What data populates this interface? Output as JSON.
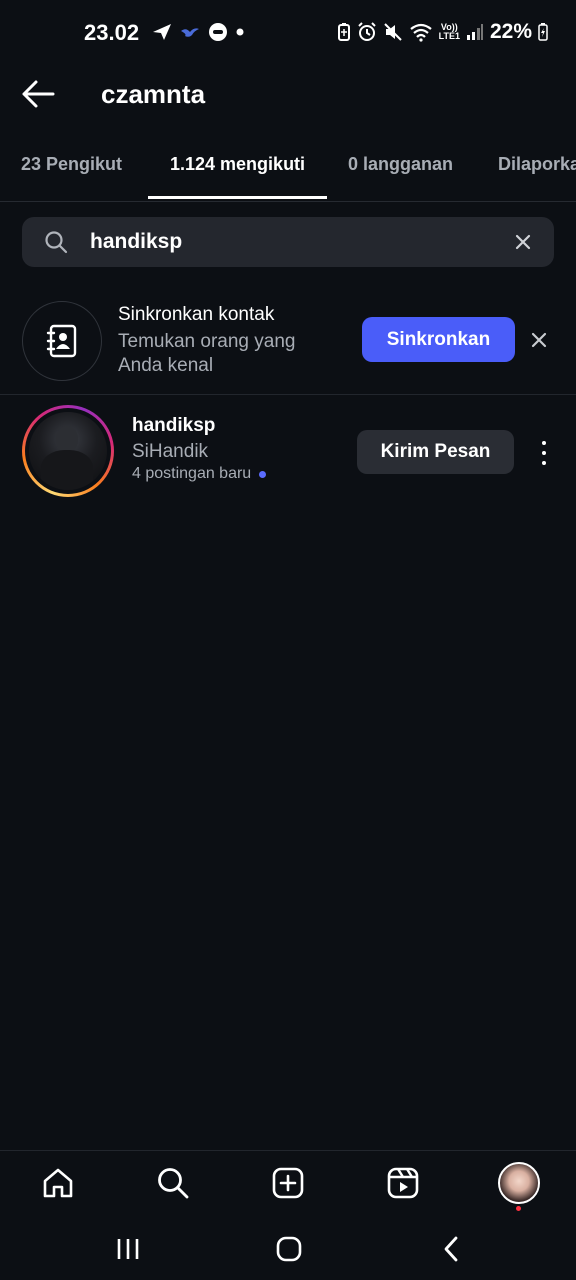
{
  "status_bar": {
    "time": "23.02",
    "battery": "22%",
    "network_top": "Vo))",
    "network_bottom": "LTE1"
  },
  "header": {
    "title": "czamnta"
  },
  "tabs": [
    {
      "label": "23 Pengikut"
    },
    {
      "label": "1.124 mengikuti"
    },
    {
      "label": "0 langganan"
    },
    {
      "label": "Dilaporkan"
    }
  ],
  "search": {
    "value": "handiksp"
  },
  "sync": {
    "title": "Sinkronkan kontak",
    "subtitle": "Temukan orang yang Anda kenal",
    "button_label": "Sinkronkan"
  },
  "results": [
    {
      "username": "handiksp",
      "full_name": "SiHandik",
      "posts_note": "4 postingan baru",
      "button_label": "Kirim Pesan"
    }
  ],
  "colors": {
    "background": "#0c0f14",
    "accent": "#4a5df9",
    "secondary_button": "#2a2d34",
    "new_dot": "#5b6cff",
    "notification_dot": "#ff3040"
  },
  "icons": {
    "back": "arrow-left-icon",
    "search": "search-icon",
    "clear": "close-icon",
    "contacts": "contact-book-icon",
    "more": "more-vertical-icon",
    "nav": [
      "home-icon",
      "search-icon",
      "create-icon",
      "reels-icon",
      "profile-avatar"
    ],
    "system": [
      "recent-apps-icon",
      "home-button-icon",
      "back-icon"
    ]
  }
}
